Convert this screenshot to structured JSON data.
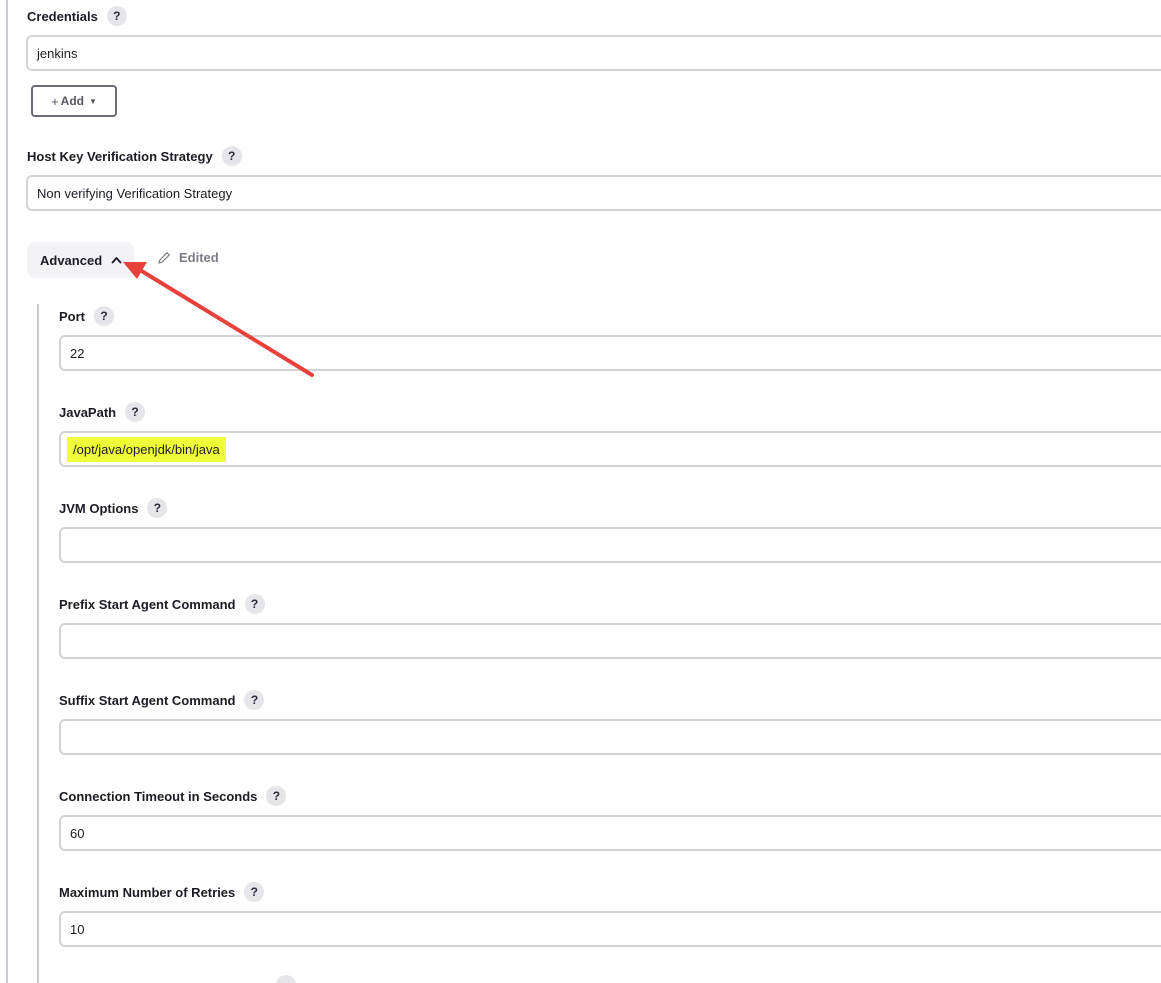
{
  "fields": {
    "credentials": {
      "label": "Credentials",
      "value": "jenkins"
    },
    "host_key": {
      "label": "Host Key Verification Strategy",
      "value": "Non verifying Verification Strategy"
    },
    "port": {
      "label": "Port",
      "value": "22"
    },
    "java_path": {
      "label": "JavaPath",
      "value": "/opt/java/openjdk/bin/java"
    },
    "jvm_options": {
      "label": "JVM Options",
      "value": ""
    },
    "prefix_cmd": {
      "label": "Prefix Start Agent Command",
      "value": ""
    },
    "suffix_cmd": {
      "label": "Suffix Start Agent Command",
      "value": ""
    },
    "timeout": {
      "label": "Connection Timeout in Seconds",
      "value": "60"
    },
    "max_retries": {
      "label": "Maximum Number of Retries",
      "value": "10"
    }
  },
  "help_glyph": "?",
  "add_button": {
    "plus": "+",
    "label": "Add",
    "caret": "▼"
  },
  "advanced": {
    "label": "Advanced",
    "expanded": true,
    "edited_label": "Edited"
  },
  "annotation": {
    "arrow_color": "#e8413c",
    "highlight_color": "#efff3a"
  },
  "icons": [
    "help-icon",
    "chevron-up-icon",
    "pencil-icon",
    "caret-down-icon"
  ]
}
